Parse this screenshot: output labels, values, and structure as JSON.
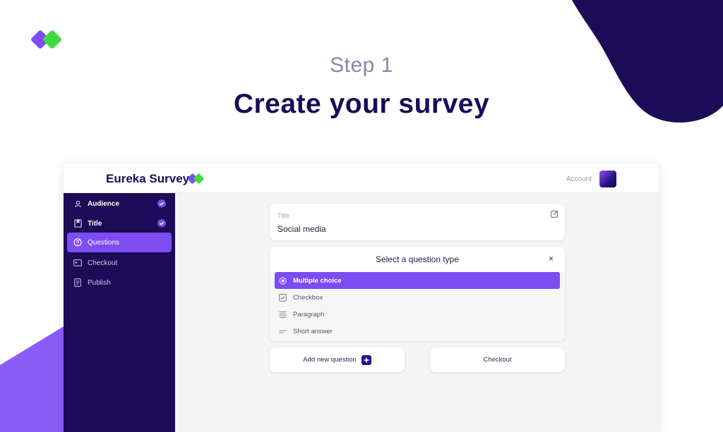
{
  "header": {
    "step": "Step 1",
    "headline": "Create your survey"
  },
  "colors": {
    "navy": "#1c0b56",
    "purple": "#7d4df2",
    "green": "#3ddc3c",
    "muted": "#8a86a8"
  },
  "app": {
    "brand": "Eureka Surveys",
    "account_label": "Account",
    "sidebar": {
      "items": [
        {
          "label": "Audience",
          "icon": "user-icon",
          "done": true
        },
        {
          "label": "Title",
          "icon": "bookmark-icon",
          "done": true
        },
        {
          "label": "Questions",
          "icon": "question-icon",
          "active": true
        },
        {
          "label": "Checkout",
          "icon": "card-icon"
        },
        {
          "label": "Publish",
          "icon": "document-icon"
        }
      ]
    },
    "title_card": {
      "label": "Title",
      "value": "Social media"
    },
    "question_type": {
      "heading": "Select a question type",
      "close": "×",
      "options": [
        {
          "label": "Multiple choice",
          "icon": "radio-icon",
          "selected": true
        },
        {
          "label": "Checkbox",
          "icon": "checkbox-icon"
        },
        {
          "label": "Paragraph",
          "icon": "paragraph-icon"
        },
        {
          "label": "Short answer",
          "icon": "short-answer-icon"
        }
      ]
    },
    "buttons": {
      "add_question": "Add new question",
      "checkout": "Checkout"
    }
  }
}
